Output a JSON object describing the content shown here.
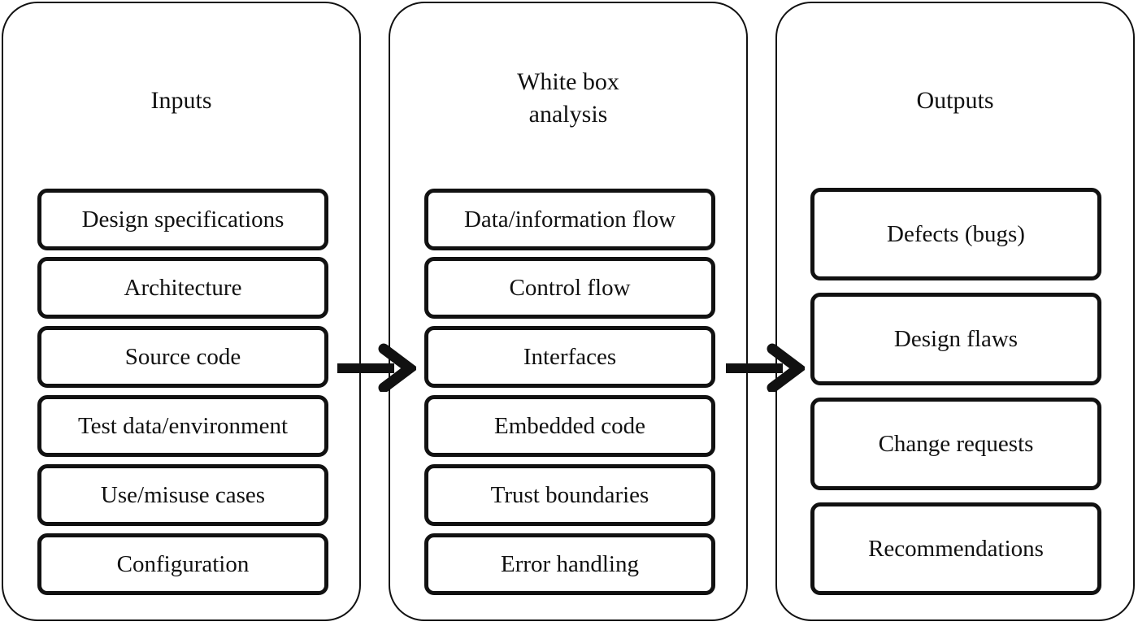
{
  "panels": [
    {
      "title": "Inputs",
      "items": [
        "Design specifications",
        "Architecture",
        "Source code",
        "Test data/environment",
        "Use/misuse cases",
        "Configuration"
      ]
    },
    {
      "title": "White box\nanalysis",
      "items": [
        "Data/information flow",
        "Control flow",
        "Interfaces",
        "Embedded code",
        "Trust boundaries",
        "Error handling"
      ]
    },
    {
      "title": "Outputs",
      "items": [
        "Defects (bugs)",
        "Design flaws",
        "Change requests",
        "Recommendations"
      ]
    }
  ],
  "arrows": [
    {
      "from": "Inputs",
      "to": "White box analysis",
      "icon": "right-arrow-icon"
    },
    {
      "from": "White box analysis",
      "to": "Outputs",
      "icon": "right-arrow-icon"
    }
  ]
}
